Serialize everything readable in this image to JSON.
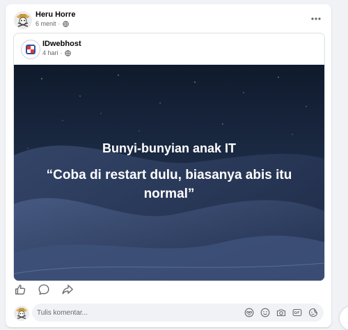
{
  "post": {
    "author_name": "Heru Horre",
    "time": "6 menit",
    "separator": "·",
    "privacy_icon": "globe-icon",
    "more_icon": "more-horizontal-icon"
  },
  "shared": {
    "page_name": "IDwebhost",
    "time": "4 hari",
    "separator": "·",
    "privacy_icon": "globe-icon",
    "image": {
      "title": "Bunyi-bunyian anak IT",
      "quote": "“Coba di restart dulu, biasanya abis itu normal”"
    }
  },
  "actions": [
    {
      "icon": "like-icon"
    },
    {
      "icon": "comment-icon"
    },
    {
      "icon": "share-icon"
    }
  ],
  "comment": {
    "placeholder": "Tulis komentar...",
    "tools": [
      "avatar-sticker-icon",
      "emoji-icon",
      "camera-icon",
      "gif-icon",
      "sticker-icon"
    ]
  },
  "colors": {
    "background": "#f0f2f5",
    "card": "#ffffff",
    "text_primary": "#050505",
    "text_secondary": "#65676b",
    "image_dark": "#152033"
  }
}
